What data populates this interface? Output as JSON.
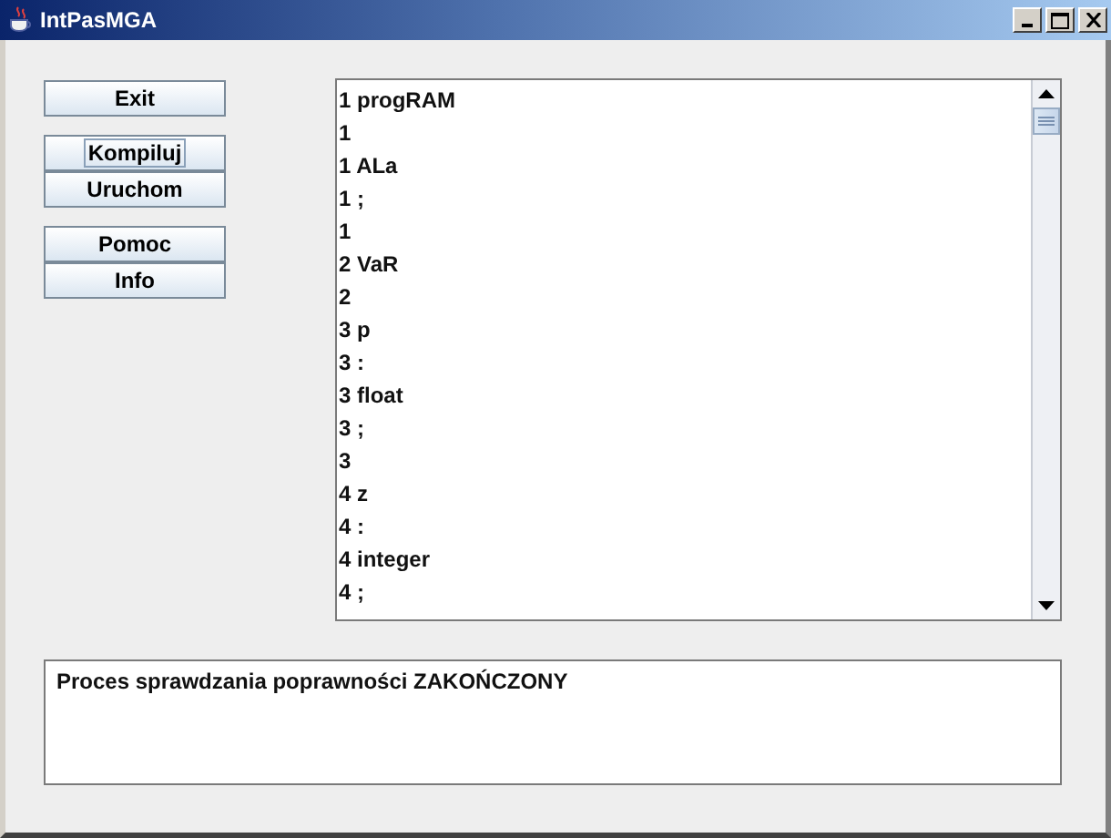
{
  "window": {
    "title": "IntPasMGA",
    "controls": [
      {
        "kind": "minimize"
      },
      {
        "kind": "maximize"
      },
      {
        "kind": "close"
      }
    ]
  },
  "button_groups": [
    {
      "buttons": [
        {
          "label": "Exit",
          "focused": false
        }
      ]
    },
    {
      "buttons": [
        {
          "label": "Kompiluj",
          "focused": true
        },
        {
          "label": "Uruchom",
          "focused": false
        }
      ]
    },
    {
      "buttons": [
        {
          "label": "Pomoc",
          "focused": false
        },
        {
          "label": "Info",
          "focused": false
        }
      ]
    }
  ],
  "listing": {
    "lines": [
      "1 progRAM",
      "1",
      "1 ALa",
      "1 ;",
      "1",
      "2 VaR",
      "2",
      "3 p",
      "3 :",
      "3 float",
      "3 ;",
      "3",
      "4 z",
      "4 :",
      "4 integer",
      "4 ;"
    ]
  },
  "message": {
    "text": "Proces sprawdzania poprawności ZAKOŃCZONY"
  }
}
